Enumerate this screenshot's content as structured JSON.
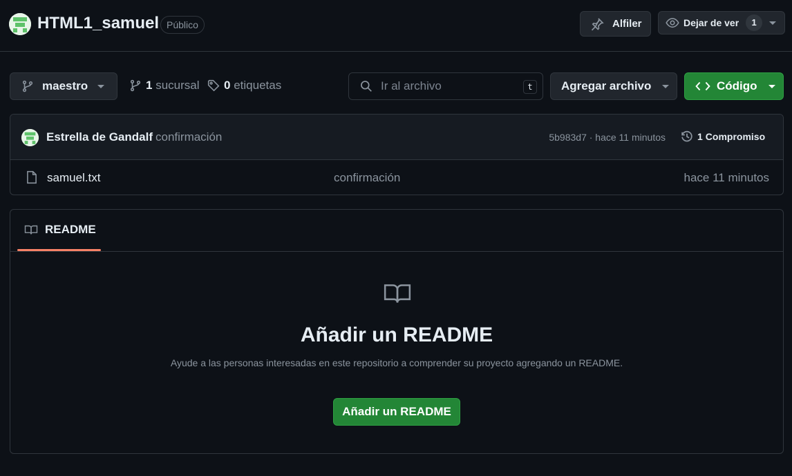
{
  "header": {
    "repo_name": "HTML1_samuel",
    "visibility": "Público",
    "pin_label": "Alfiler",
    "watch_label": "Dejar de ver",
    "watch_count": "1"
  },
  "toolbar": {
    "branch": "maestro",
    "branches_count": "1",
    "branches_label": "sucursal",
    "tags_count": "0",
    "tags_label": "etiquetas",
    "search_placeholder": "Ir al archivo",
    "search_shortcut": "t",
    "add_file_label": "Agregar archivo",
    "code_label": "Código"
  },
  "commit": {
    "author": "Estrella de Gandalf",
    "message": "confirmación",
    "hash_time": "5b983d7 · hace 11 minutos",
    "commits_count": "1",
    "commits_label": "Compromiso"
  },
  "files": [
    {
      "name": "samuel.txt",
      "message": "confirmación",
      "time": "hace 11 minutos"
    }
  ],
  "readme": {
    "tab_label": "README",
    "title": "Añadir un README",
    "description": "Ayude a las personas interesadas en este repositorio a comprender su proyecto agregando un README.",
    "button_label": "Añadir un README"
  },
  "colors": {
    "background": "#0d1117",
    "accent_green": "#238636",
    "tab_accent": "#f78166",
    "border": "#30363d"
  },
  "icons": [
    "identicon-avatar",
    "pin-icon",
    "eye-icon",
    "branch-icon",
    "tag-icon",
    "search-icon",
    "code-icon",
    "history-icon",
    "file-icon",
    "book-icon"
  ]
}
